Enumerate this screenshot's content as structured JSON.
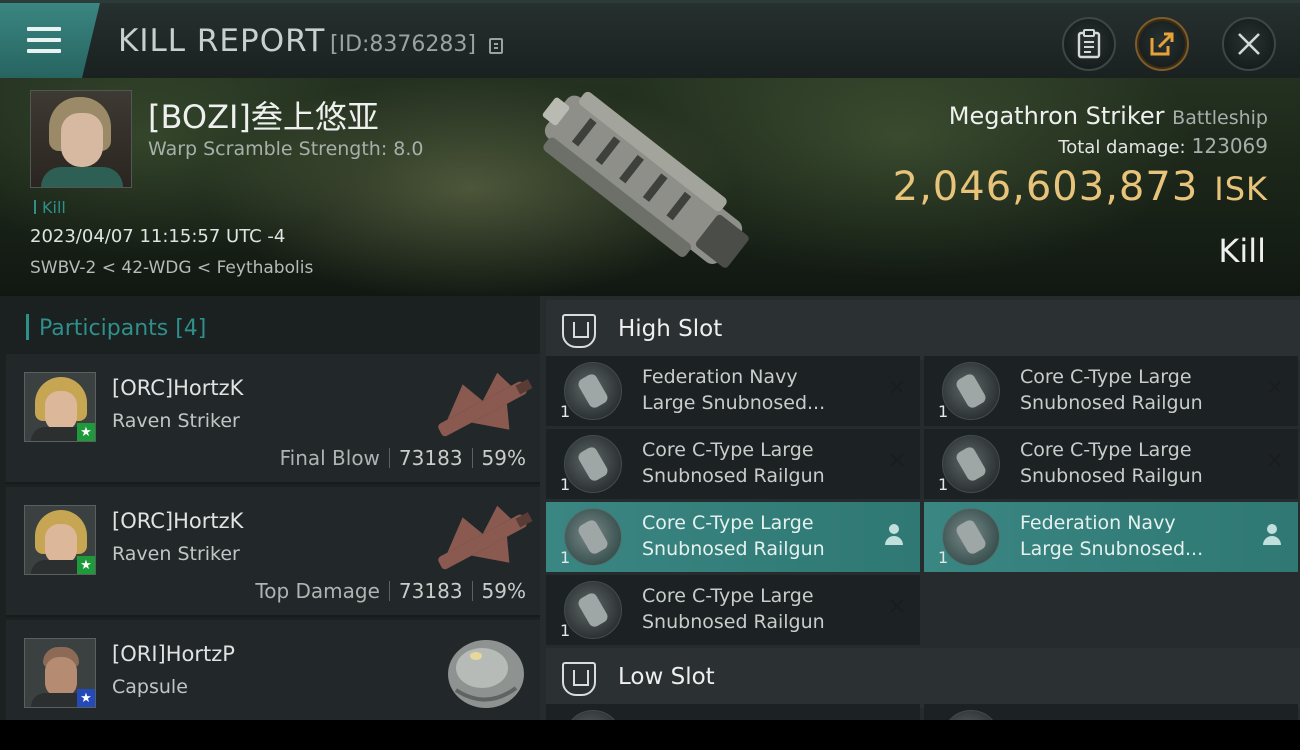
{
  "header": {
    "title": "KILL REPORT",
    "report_id": "[ID:8376283]"
  },
  "victim": {
    "name": "[BOZI]叁上悠亚",
    "warp_scramble": "Warp Scramble Strength: 8.0",
    "kill_tag": "Kill",
    "datetime": "2023/04/07 11:15:57 UTC -4",
    "location": "SWBV-2 < 42-WDG < Feythabolis",
    "ship_name": "Megathron Striker",
    "ship_class": "Battleship",
    "total_damage_label": "Total damage:",
    "total_damage": "123069",
    "isk_value": "2,046,603,873",
    "isk_unit": "ISK",
    "result": "Kill"
  },
  "participants": {
    "heading": "Participants [4]",
    "rows": [
      {
        "name": "[ORC]HortzK",
        "ship": "Raven Striker",
        "label": "Final Blow",
        "damage": "73183",
        "percent": "59%",
        "badge": "★"
      },
      {
        "name": "[ORC]HortzK",
        "ship": "Raven Striker",
        "label": "Top Damage",
        "damage": "73183",
        "percent": "59%",
        "badge": "★"
      },
      {
        "name": "[ORI]HortzP",
        "ship": "Capsule",
        "badge": "★"
      }
    ]
  },
  "fitting": {
    "high_slot_title": "High Slot",
    "low_slot_title": "Low Slot",
    "high_slot": [
      {
        "qty": "1",
        "name_1": "Federation Navy",
        "name_2": "Large Snubnosed...",
        "status": "destroyed"
      },
      {
        "qty": "1",
        "name_1": "Core C-Type Large",
        "name_2": "Snubnosed Railgun",
        "status": "destroyed"
      },
      {
        "qty": "1",
        "name_1": "Core C-Type Large",
        "name_2": "Snubnosed Railgun",
        "status": "destroyed"
      },
      {
        "qty": "1",
        "name_1": "Core C-Type Large",
        "name_2": "Snubnosed Railgun",
        "status": "destroyed"
      },
      {
        "qty": "1",
        "name_1": "Core C-Type Large",
        "name_2": "Snubnosed Railgun",
        "status": "dropped"
      },
      {
        "qty": "1",
        "name_1": "Federation Navy",
        "name_2": "Large Snubnosed...",
        "status": "dropped"
      },
      {
        "qty": "1",
        "name_1": "Core C-Type Large",
        "name_2": "Snubnosed Railgun",
        "status": "destroyed"
      }
    ]
  },
  "icons": {
    "menu": "hamburger-icon",
    "copy": "copy-icon",
    "clipboard": "clipboard-icon",
    "share": "share-icon",
    "close": "close-icon",
    "destroyed": "x-icon",
    "dropped": "person-icon",
    "slot": "slot-icon"
  },
  "colors": {
    "accent_teal": "#2f8f8a",
    "isk_gold": "#e8c37a",
    "highlight_row": "#3a8682",
    "share_ring": "#e7a23a"
  }
}
